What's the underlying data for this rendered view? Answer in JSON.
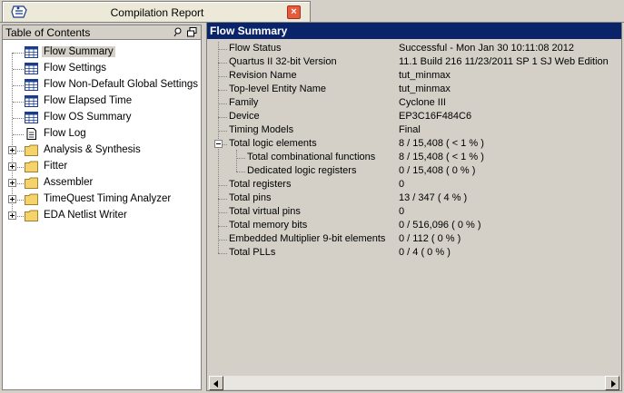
{
  "tab": {
    "title": "Compilation Report",
    "close_symbol": "×",
    "icon": "report-icon"
  },
  "toc": {
    "header": "Table of Contents",
    "items": [
      {
        "label": "Flow Summary",
        "icon": "table-icon",
        "selected": true
      },
      {
        "label": "Flow Settings",
        "icon": "table-icon"
      },
      {
        "label": "Flow Non-Default Global Settings",
        "icon": "table-icon"
      },
      {
        "label": "Flow Elapsed Time",
        "icon": "table-icon"
      },
      {
        "label": "Flow OS Summary",
        "icon": "table-icon"
      },
      {
        "label": "Flow Log",
        "icon": "document-icon"
      },
      {
        "label": "Analysis & Synthesis",
        "icon": "folder-icon"
      },
      {
        "label": "Fitter",
        "icon": "folder-icon"
      },
      {
        "label": "Assembler",
        "icon": "folder-icon"
      },
      {
        "label": "TimeQuest Timing Analyzer",
        "icon": "folder-icon"
      },
      {
        "label": "EDA Netlist Writer",
        "icon": "folder-icon"
      }
    ]
  },
  "summary": {
    "header": "Flow Summary",
    "rows": [
      {
        "key": "Flow Status",
        "value": "Successful - Mon Jan 30 10:11:08 2012"
      },
      {
        "key": "Quartus II 32-bit Version",
        "value": "11.1 Build 216 11/23/2011 SP 1 SJ Web Edition"
      },
      {
        "key": "Revision Name",
        "value": "tut_minmax"
      },
      {
        "key": "Top-level Entity Name",
        "value": "tut_minmax"
      },
      {
        "key": "Family",
        "value": "Cyclone III"
      },
      {
        "key": "Device",
        "value": "EP3C16F484C6"
      },
      {
        "key": "Timing Models",
        "value": "Final"
      },
      {
        "key": "Total logic elements",
        "value": "8 / 15,408 ( < 1 % )"
      },
      {
        "key": "Total combinational functions",
        "value": "8 / 15,408 ( < 1 % )"
      },
      {
        "key": "Dedicated logic registers",
        "value": "0 / 15,408 ( 0 % )"
      },
      {
        "key": "Total registers",
        "value": "0"
      },
      {
        "key": "Total pins",
        "value": "13 / 347 ( 4 % )"
      },
      {
        "key": "Total virtual pins",
        "value": "0"
      },
      {
        "key": "Total memory bits",
        "value": "0 / 516,096 ( 0 % )"
      },
      {
        "key": "Embedded Multiplier 9-bit elements",
        "value": "0 / 112 ( 0 % )"
      },
      {
        "key": "Total PLLs",
        "value": "0 / 4 ( 0 % )"
      }
    ]
  },
  "colors": {
    "header_bg": "#0a246a",
    "window_bg": "#d4d0c8",
    "folder": "#f5d36b",
    "close": "#e85a3c"
  }
}
